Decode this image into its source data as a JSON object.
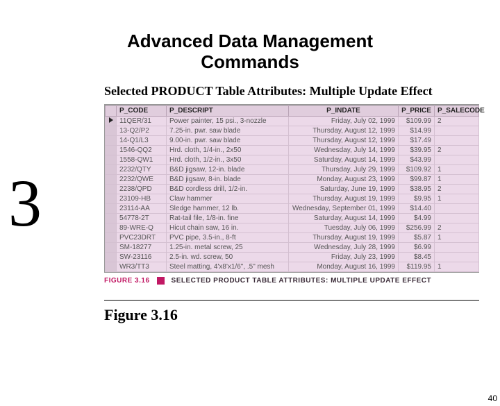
{
  "title_line1": "Advanced Data Management",
  "title_line2": "Commands",
  "subtitle": "Selected PRODUCT Table Attributes:  Multiple Update Effect",
  "big_number": "3",
  "columns": {
    "code": "P_CODE",
    "descript": "P_DESCRIPT",
    "indate": "P_INDATE",
    "price": "P_PRICE",
    "salecode": "P_SALECODE"
  },
  "rows": [
    {
      "code": "11QER/31",
      "desc": "Power painter, 15 psi., 3-nozzle",
      "date": "Friday, July 02, 1999",
      "price": "$109.99",
      "sale": "2"
    },
    {
      "code": "13-Q2/P2",
      "desc": "7.25-in. pwr. saw blade",
      "date": "Thursday, August 12, 1999",
      "price": "$14.99",
      "sale": ""
    },
    {
      "code": "14-Q1/L3",
      "desc": "9.00-in. pwr. saw blade",
      "date": "Thursday, August 12, 1999",
      "price": "$17.49",
      "sale": ""
    },
    {
      "code": "1546-QQ2",
      "desc": "Hrd. cloth, 1/4-in., 2x50",
      "date": "Wednesday, July 14, 1999",
      "price": "$39.95",
      "sale": "2"
    },
    {
      "code": "1558-QW1",
      "desc": "Hrd. cloth, 1/2-in., 3x50",
      "date": "Saturday, August 14, 1999",
      "price": "$43.99",
      "sale": ""
    },
    {
      "code": "2232/QTY",
      "desc": "B&D jigsaw, 12-in. blade",
      "date": "Thursday, July 29, 1999",
      "price": "$109.92",
      "sale": "1"
    },
    {
      "code": "2232/QWE",
      "desc": "B&D jigsaw, 8-in. blade",
      "date": "Monday, August 23, 1999",
      "price": "$99.87",
      "sale": "1"
    },
    {
      "code": "2238/QPD",
      "desc": "B&D cordless drill, 1/2-in.",
      "date": "Saturday, June 19, 1999",
      "price": "$38.95",
      "sale": "2"
    },
    {
      "code": "23109-HB",
      "desc": "Claw hammer",
      "date": "Thursday, August 19, 1999",
      "price": "$9.95",
      "sale": "1"
    },
    {
      "code": "23114-AA",
      "desc": "Sledge hammer, 12 lb.",
      "date": "Wednesday, September 01, 1999",
      "price": "$14.40",
      "sale": ""
    },
    {
      "code": "54778-2T",
      "desc": "Rat-tail file, 1/8-in. fine",
      "date": "Saturday, August 14, 1999",
      "price": "$4.99",
      "sale": ""
    },
    {
      "code": "89-WRE-Q",
      "desc": "Hicut chain saw, 16 in.",
      "date": "Tuesday, July 06, 1999",
      "price": "$256.99",
      "sale": "2"
    },
    {
      "code": "PVC23DRT",
      "desc": "PVC pipe, 3.5-in., 8-ft",
      "date": "Thursday, August 19, 1999",
      "price": "$5.87",
      "sale": "1"
    },
    {
      "code": "SM-18277",
      "desc": "1.25-in. metal screw, 25",
      "date": "Wednesday, July 28, 1999",
      "price": "$6.99",
      "sale": ""
    },
    {
      "code": "SW-23116",
      "desc": "2.5-in. wd. screw, 50",
      "date": "Friday, July 23, 1999",
      "price": "$8.45",
      "sale": ""
    },
    {
      "code": "WR3/TT3",
      "desc": "Steel matting, 4'x8'x1/6\", .5\" mesh",
      "date": "Monday, August 16, 1999",
      "price": "$119.95",
      "sale": "1"
    }
  ],
  "caption": {
    "fig_id": "FIGURE 3.16",
    "text": "SELECTED PRODUCT TABLE ATTRIBUTES: MULTIPLE UPDATE EFFECT"
  },
  "figure_label": "Figure 3.16",
  "page_number": "40"
}
